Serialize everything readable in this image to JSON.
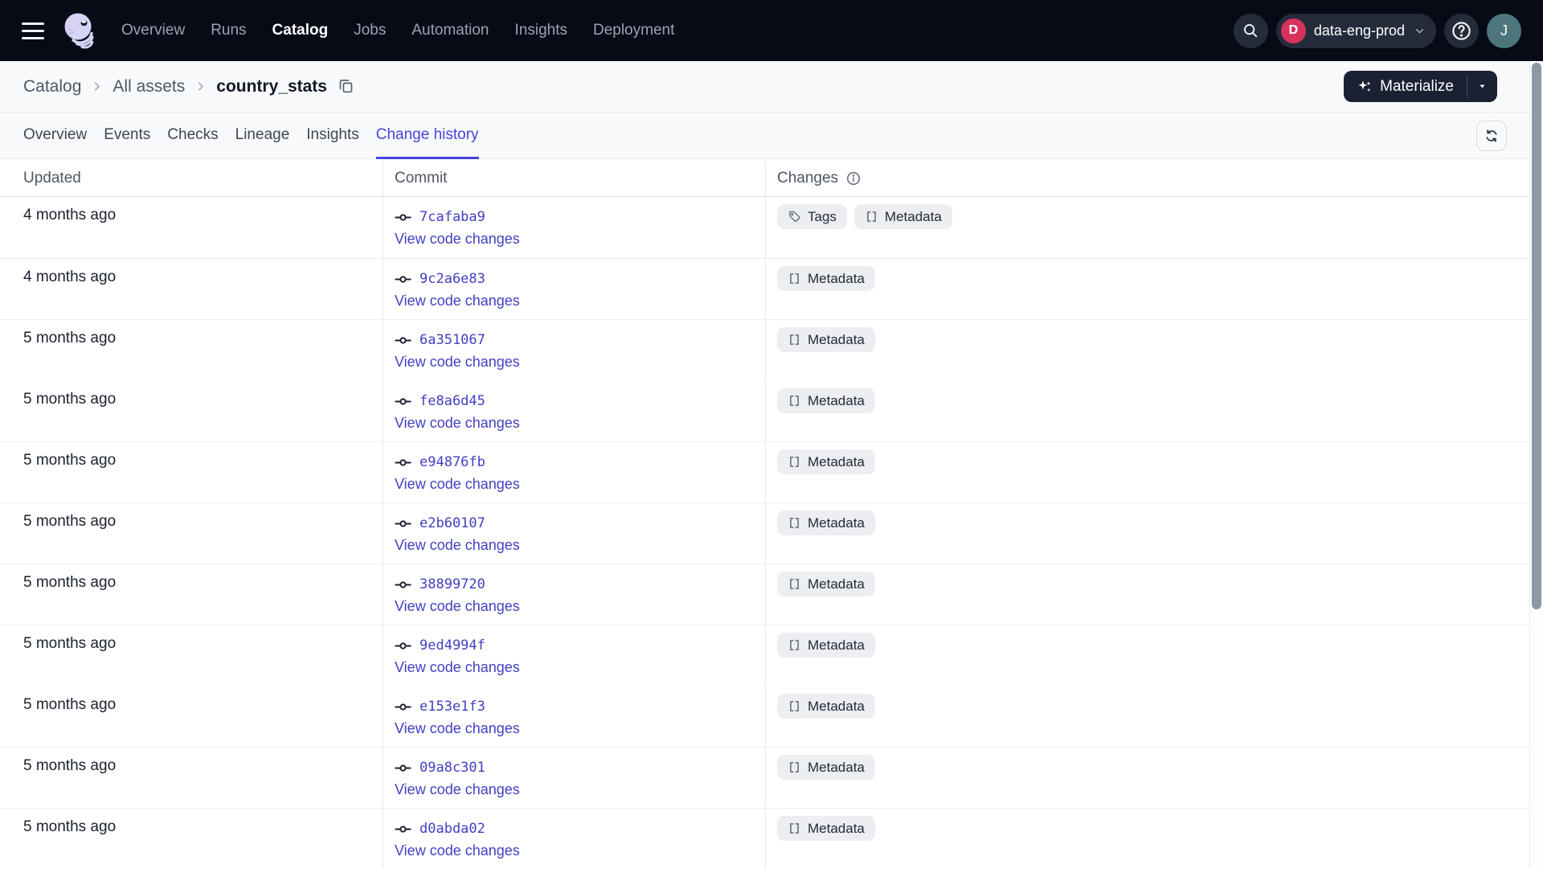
{
  "topbar": {
    "nav": [
      {
        "label": "Overview",
        "active": false
      },
      {
        "label": "Runs",
        "active": false
      },
      {
        "label": "Catalog",
        "active": true
      },
      {
        "label": "Jobs",
        "active": false
      },
      {
        "label": "Automation",
        "active": false
      },
      {
        "label": "Insights",
        "active": false
      },
      {
        "label": "Deployment",
        "active": false
      }
    ],
    "org": {
      "initial": "D",
      "name": "data-eng-prod"
    },
    "user_initial": "J"
  },
  "breadcrumb": {
    "items": [
      "Catalog",
      "All assets"
    ],
    "current": "country_stats"
  },
  "actions": {
    "materialize": "Materialize"
  },
  "tabs": [
    {
      "label": "Overview",
      "active": false
    },
    {
      "label": "Events",
      "active": false
    },
    {
      "label": "Checks",
      "active": false
    },
    {
      "label": "Lineage",
      "active": false
    },
    {
      "label": "Insights",
      "active": false
    },
    {
      "label": "Change history",
      "active": true
    }
  ],
  "table": {
    "columns": [
      "Updated",
      "Commit",
      "Changes"
    ],
    "link_label": "View code changes",
    "rows": [
      {
        "updated": "4 months ago",
        "commit": "7cafaba9",
        "changes": [
          "Tags",
          "Metadata"
        ],
        "seamless": false
      },
      {
        "updated": "4 months ago",
        "commit": "9c2a6e83",
        "changes": [
          "Metadata"
        ],
        "seamless": false
      },
      {
        "updated": "5 months ago",
        "commit": "6a351067",
        "changes": [
          "Metadata"
        ],
        "seamless": false
      },
      {
        "updated": "5 months ago",
        "commit": "fe8a6d45",
        "changes": [
          "Metadata"
        ],
        "seamless": true
      },
      {
        "updated": "5 months ago",
        "commit": "e94876fb",
        "changes": [
          "Metadata"
        ],
        "seamless": false
      },
      {
        "updated": "5 months ago",
        "commit": "e2b60107",
        "changes": [
          "Metadata"
        ],
        "seamless": false
      },
      {
        "updated": "5 months ago",
        "commit": "38899720",
        "changes": [
          "Metadata"
        ],
        "seamless": false
      },
      {
        "updated": "5 months ago",
        "commit": "9ed4994f",
        "changes": [
          "Metadata"
        ],
        "seamless": false
      },
      {
        "updated": "5 months ago",
        "commit": "e153e1f3",
        "changes": [
          "Metadata"
        ],
        "seamless": true
      },
      {
        "updated": "5 months ago",
        "commit": "09a8c301",
        "changes": [
          "Metadata"
        ],
        "seamless": false
      },
      {
        "updated": "5 months ago",
        "commit": "d0abda02",
        "changes": [
          "Metadata"
        ],
        "seamless": false
      }
    ]
  },
  "colors": {
    "topbar_bg": "#070B16",
    "nav_inactive": "#9BA3B4",
    "pill_bg": "#242B3A",
    "org_badge": "#D8335C",
    "avatar_bg": "#4C767C",
    "band_bg": "#F8F9FA",
    "border": "#E7E9EE",
    "row_border": "#ECEEF1",
    "accent": "#4643DF",
    "link": "#4240C2",
    "text_dark": "#1A212E",
    "text_header": "#4D5563",
    "badge_bg": "#EDEEF2",
    "badge_icon": "#5E6878",
    "dark_button_bg": "#1A2133",
    "scroll_thumb": "#8D97A7"
  }
}
